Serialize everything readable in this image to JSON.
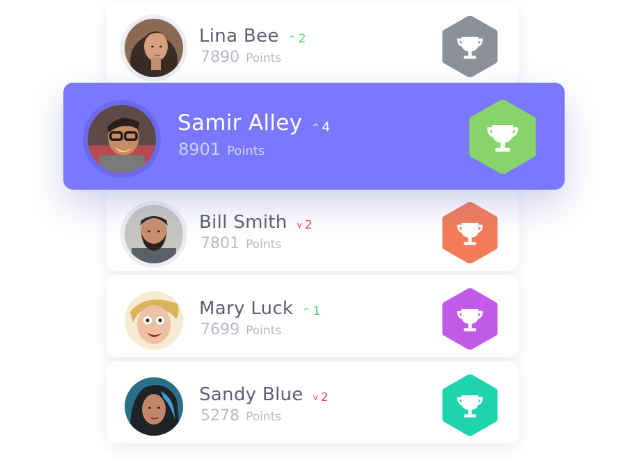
{
  "leaderboard": [
    {
      "name": "Lina Bee",
      "change_direction": "up",
      "change": "2",
      "points": "7890",
      "points_label": "Points",
      "badge_color": "#8b9099",
      "avatar_icon": "avatar-lina-bee"
    },
    {
      "name": "Samir Alley",
      "change_direction": "up",
      "change": "4",
      "points": "8901",
      "points_label": "Points",
      "badge_color": "#86d46a",
      "avatar_icon": "avatar-samir-alley",
      "highlighted": true
    },
    {
      "name": "Bill Smith",
      "change_direction": "down",
      "change": "2",
      "points": "7801",
      "points_label": "Points",
      "badge_color": "#f47d58",
      "avatar_icon": "avatar-bill-smith"
    },
    {
      "name": "Mary Luck",
      "change_direction": "up",
      "change": "1",
      "points": "7699",
      "points_label": "Points",
      "badge_color": "#c25ae8",
      "avatar_icon": "avatar-mary-luck"
    },
    {
      "name": "Sandy Blue",
      "change_direction": "down",
      "change": "2",
      "points": "5278",
      "points_label": "Points",
      "badge_color": "#1fd3ad",
      "avatar_icon": "avatar-sandy-blue"
    }
  ],
  "colors": {
    "highlight_background": "#7a78fe",
    "up": "#41d36a",
    "down": "#f0484c"
  },
  "icons": {
    "up": "caret-up-icon",
    "down": "caret-down-icon",
    "badge": "trophy-icon"
  }
}
